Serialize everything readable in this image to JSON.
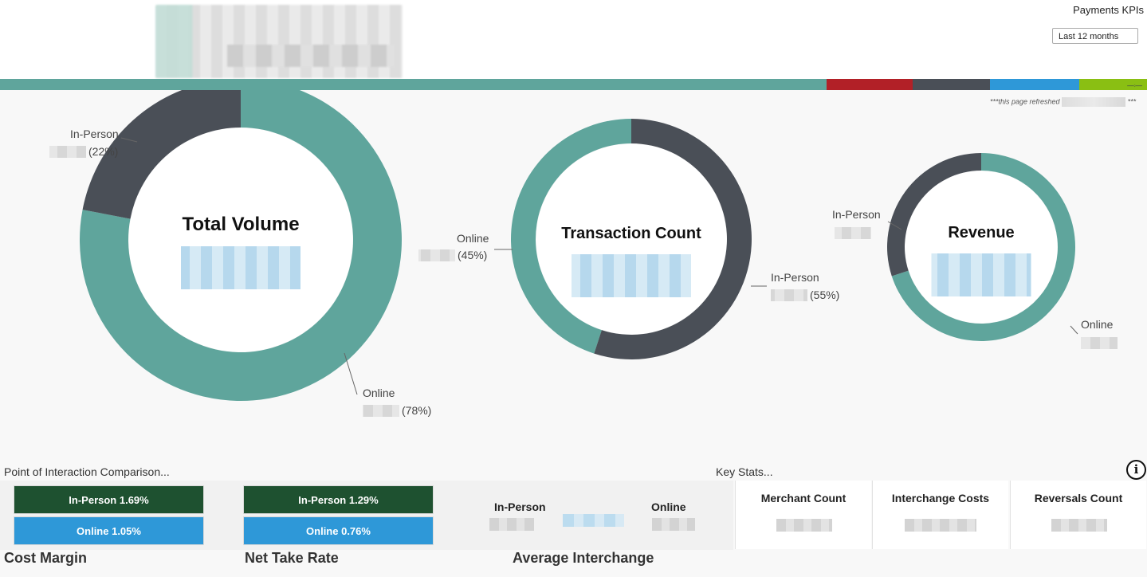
{
  "header": {
    "page_title": "Payments KPIs",
    "period_value": "Last 12 months",
    "refresh_note": "***this page refreshed",
    "refresh_note_tail": "***"
  },
  "colors": {
    "online": "#5fa59c",
    "in_person": "#4a4f57",
    "green_box": "#1e5130",
    "blue_box": "#2e98d8"
  },
  "color_bar": [
    "#5fa59c",
    "#b22027",
    "#4a4f57",
    "#2e98d8",
    "#8abf13"
  ],
  "chart_data": [
    {
      "type": "pie",
      "title": "Total Volume",
      "categories": [
        "Online",
        "In-Person"
      ],
      "values": [
        78,
        22
      ],
      "labels": [
        "(78%)",
        "(22%)"
      ]
    },
    {
      "type": "pie",
      "title": "Transaction Count",
      "categories": [
        "Online",
        "In-Person"
      ],
      "values": [
        45,
        55
      ],
      "labels": [
        "(45%)",
        "(55%)"
      ]
    },
    {
      "type": "pie",
      "title": "Revenue",
      "categories": [
        "Online",
        "In-Person"
      ],
      "values": [
        70,
        30
      ],
      "labels": [
        "",
        ""
      ]
    }
  ],
  "poi": {
    "section_label": "Point of Interaction Comparison...",
    "cost_margin": {
      "in_person": "In-Person 1.69%",
      "online": "Online 1.05%",
      "caption": "Cost Margin"
    },
    "net_take_rate": {
      "in_person": "In-Person 1.29%",
      "online": "Online 0.76%",
      "caption": "Net Take Rate"
    },
    "avg_interchange": {
      "in_person_label": "In-Person",
      "online_label": "Online",
      "caption": "Average Interchange"
    }
  },
  "key_stats": {
    "section_label": "Key Stats...",
    "cards": [
      {
        "title": "Merchant Count"
      },
      {
        "title": "Interchange Costs"
      },
      {
        "title": "Reversals Count"
      }
    ],
    "info_icon": "i"
  }
}
